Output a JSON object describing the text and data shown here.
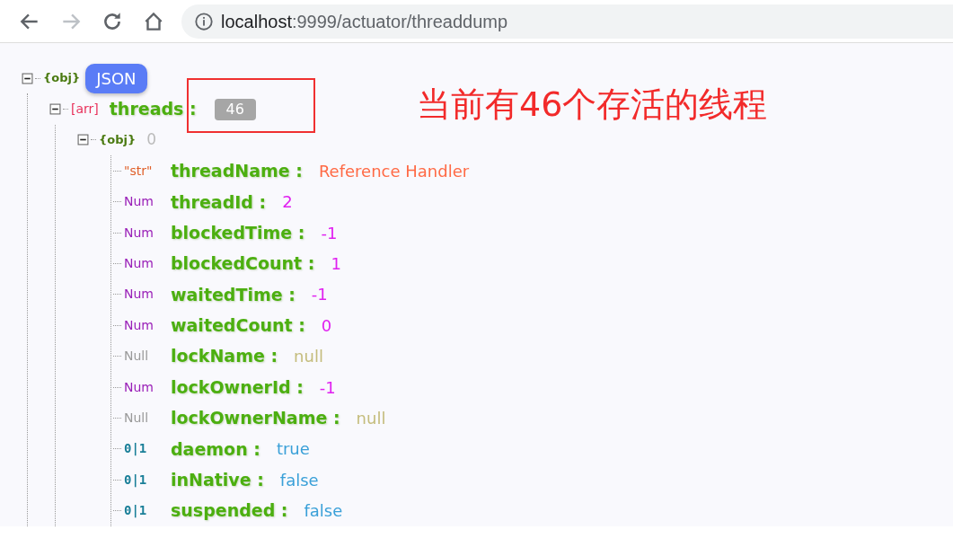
{
  "browser": {
    "back_enabled": true,
    "forward_enabled": false,
    "url_host": "localhost",
    "url_rest": ":9999/actuator/threaddump"
  },
  "tree": {
    "kind": "object",
    "tag": "{obj}",
    "expanded": true,
    "badge": "JSON",
    "children": [
      {
        "kind": "array",
        "tag": "[arr]",
        "key": "threads :",
        "count": "46",
        "expanded": true,
        "children": [
          {
            "kind": "object",
            "tag": "{obj}",
            "index": "0",
            "expanded": true,
            "children": [
              {
                "kind": "str",
                "tag": "\"str\"",
                "key": "threadName :",
                "value": "Reference Handler"
              },
              {
                "kind": "num",
                "tag": "Num",
                "key": "threadId :",
                "value": "2"
              },
              {
                "kind": "num",
                "tag": "Num",
                "key": "blockedTime :",
                "value": "-1"
              },
              {
                "kind": "num",
                "tag": "Num",
                "key": "blockedCount :",
                "value": "1"
              },
              {
                "kind": "num",
                "tag": "Num",
                "key": "waitedTime :",
                "value": "-1"
              },
              {
                "kind": "num",
                "tag": "Num",
                "key": "waitedCount :",
                "value": "0"
              },
              {
                "kind": "null",
                "tag": "Null",
                "key": "lockName :",
                "value": "null"
              },
              {
                "kind": "num",
                "tag": "Num",
                "key": "lockOwnerId :",
                "value": "-1"
              },
              {
                "kind": "null",
                "tag": "Null",
                "key": "lockOwnerName :",
                "value": "null"
              },
              {
                "kind": "bool",
                "tag": "0|1",
                "key": "daemon :",
                "value": "true"
              },
              {
                "kind": "bool",
                "tag": "0|1",
                "key": "inNative :",
                "value": "false"
              },
              {
                "kind": "bool",
                "tag": "0|1",
                "key": "suspended :",
                "value": "false"
              }
            ]
          }
        ]
      }
    ]
  },
  "annotation": {
    "text": "当前有46个存活的线程"
  }
}
